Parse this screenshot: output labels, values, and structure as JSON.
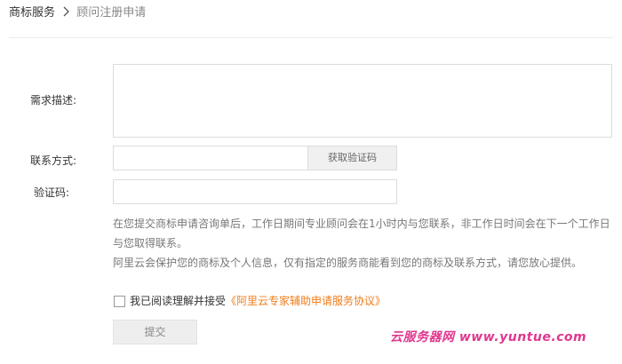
{
  "breadcrumb": {
    "first": "商标服务",
    "current": "顾问注册申请"
  },
  "form": {
    "description_label": "需求描述:",
    "description_value": "",
    "contact_label": "联系方式:",
    "contact_value": "",
    "get_code_label": "获取验证码",
    "code_label": "验证码:",
    "code_value": ""
  },
  "notice": {
    "line1": "在您提交商标申请咨询单后，工作日期间专业顾问会在1小时内与您联系，非工作日时间会在下一个工作日与您取得联系。",
    "line2": "阿里云会保护您的商标及个人信息，仅有指定的服务商能看到您的商标及联系方式，请您放心提供。"
  },
  "agreement": {
    "checked": false,
    "text": "我已阅读理解并接受",
    "link": "《阿里云专家辅助申请服务协议》"
  },
  "submit_label": "提交",
  "watermark": {
    "cn": "云服务器网",
    "en": "www.yuntue.com"
  },
  "colors": {
    "link": "#f07d1a",
    "watermark": "#e0378f"
  }
}
